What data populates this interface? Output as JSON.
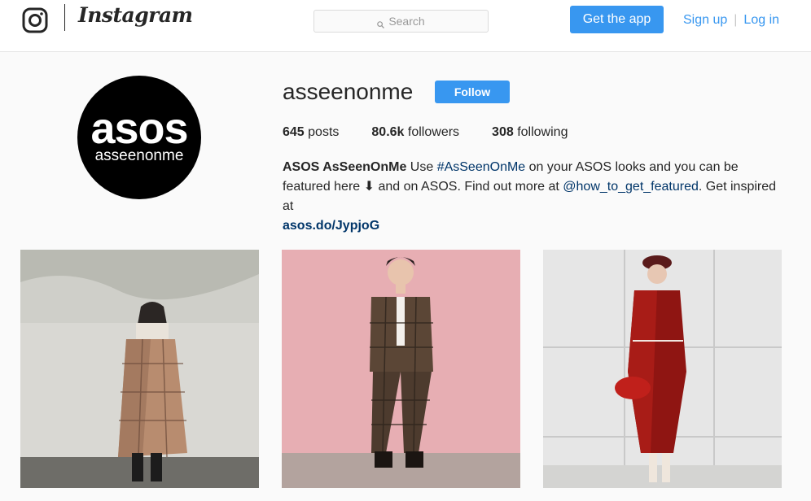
{
  "nav": {
    "brand": "Instagram",
    "search_placeholder": "Search",
    "get_app_label": "Get the app",
    "signup_label": "Sign up",
    "separator": "|",
    "login_label": "Log in"
  },
  "profile": {
    "avatar_top": "asos",
    "avatar_bottom": "asseenonme",
    "username": "asseenonme",
    "follow_label": "Follow",
    "stats": {
      "posts_count": "645",
      "posts_label": "posts",
      "followers_count": "80.6k",
      "followers_label": "followers",
      "following_count": "308",
      "following_label": "following"
    },
    "bio": {
      "name": "ASOS AsSeenOnMe",
      "text1": " Use ",
      "hashtag": "#AsSeenOnMe",
      "text2": " on your ASOS looks and you can be featured here ⬇ and on ASOS. Find out more at ",
      "mention": "@how_to_get_featured",
      "text3": ". Get inspired at ",
      "url": "asos.do/JypjoG"
    }
  },
  "posts": [
    {
      "subject": "woman in plaid coat"
    },
    {
      "subject": "man in plaid suit"
    },
    {
      "subject": "woman in red vinyl coat"
    }
  ],
  "colors": {
    "accent": "#3897f0",
    "link": "#003569",
    "background": "#fafafa"
  }
}
